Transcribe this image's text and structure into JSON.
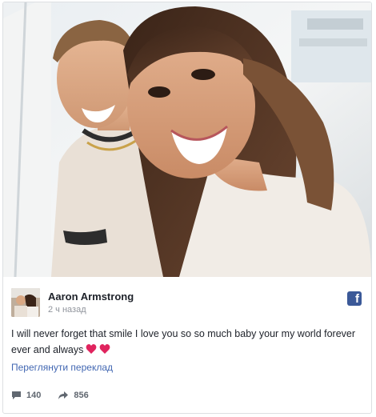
{
  "post": {
    "author_name": "Aaron Armstrong",
    "time": "2 ч назад",
    "text": "I will never forget that smile I love you so so much baby your my world forever ever and always",
    "emoji": "two-hearts",
    "translate_link": "Переглянути переклад",
    "platform_icon": "facebook-icon"
  },
  "stats": {
    "comments": "140",
    "shares": "856"
  },
  "colors": {
    "link": "#4267b2",
    "facebook_brand": "#3b5998",
    "heart": "#e0245e"
  }
}
